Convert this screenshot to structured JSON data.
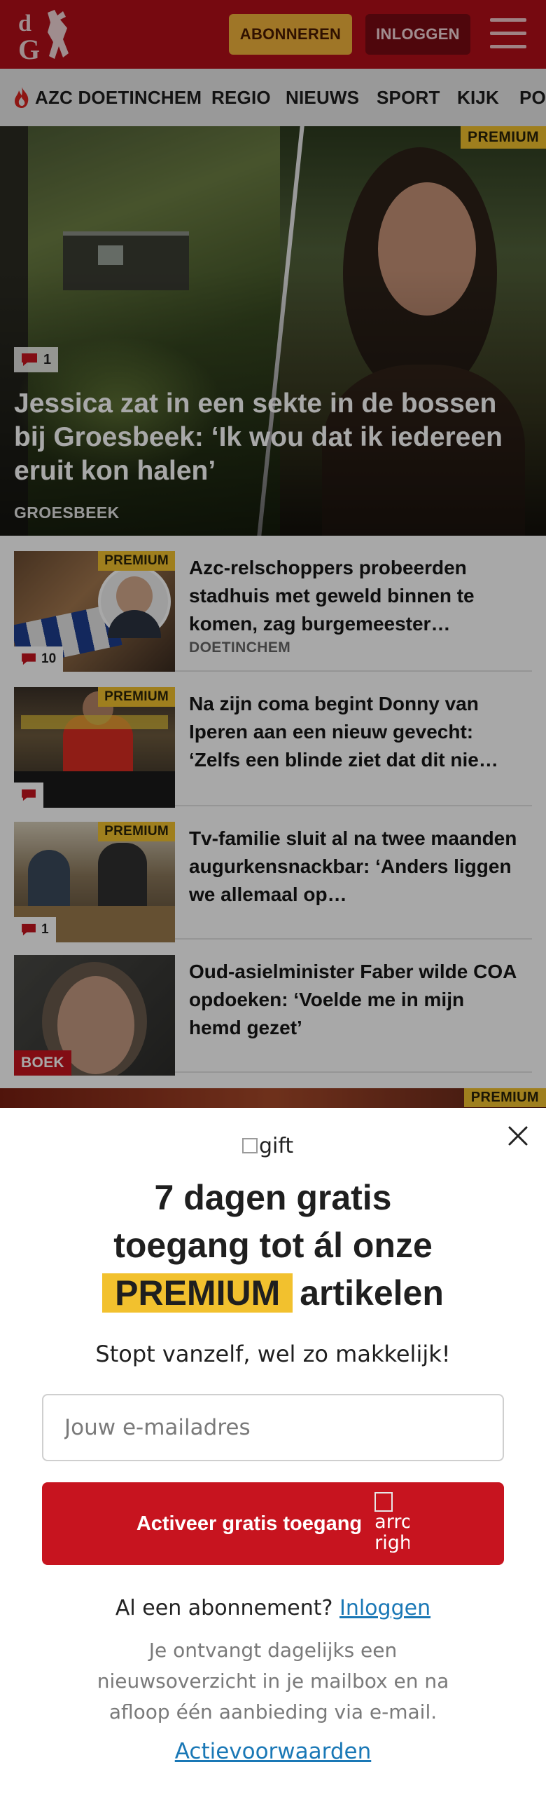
{
  "header": {
    "logo_text": "dG",
    "subscribe_label": "ABONNEREN",
    "login_label": "INLOGGEN",
    "brand_color": "#b30f19",
    "subscribe_color": "#f2b43c",
    "login_color": "#780a13"
  },
  "nav": {
    "items": [
      {
        "label": "AZC DOETINCHEM",
        "icon": "flame-icon"
      },
      {
        "label": "REGIO"
      },
      {
        "label": "NIEUWS"
      },
      {
        "label": "SPORT"
      },
      {
        "label": "KIJK"
      },
      {
        "label": "PO"
      }
    ]
  },
  "hero": {
    "premium": "PREMIUM",
    "comments": "1",
    "title": "Jessica zat in een sekte in de bossen bij Groesbeek: ‘Ik wou dat ik iedereen eruit kon halen’",
    "location": "GROESBEEK"
  },
  "articles": [
    {
      "title": "Azc-relschoppers probeerden stadhuis met geweld binnen te komen, zag burgemeester…",
      "location": "DOETINCHEM",
      "premium": "PREMIUM",
      "comments": "10"
    },
    {
      "title": "Na zijn coma begint Donny van Iperen aan een nieuw gevecht: ‘Zelfs een blinde ziet dat dit nie…",
      "premium": "PREMIUM",
      "comments": ""
    },
    {
      "title": "Tv-familie sluit al na twee maanden augurkensnackbar: ‘Anders liggen we allemaal op…",
      "premium": "PREMIUM",
      "comments": "1"
    },
    {
      "title": "Oud-asielminister Faber wilde COA opdoeken: ‘Voelde me in mijn hemd gezet’",
      "badge": "BOEK"
    }
  ],
  "peek_premium": "PREMIUM",
  "modal": {
    "gift_alt": "gift",
    "title_line1": "7 dagen gratis",
    "title_line2": "toegang tot ál onze",
    "title_highlight": "PREMIUM",
    "title_rest": "artikelen",
    "subtitle": "Stopt vanzelf, wel zo makkelijk!",
    "email_placeholder": "Jouw e-mailadres",
    "cta_label": "Activeer gratis toegang",
    "cta_icon_alt": "arrow-right",
    "already_text": "Al een abonnement?",
    "already_link": "Inloggen",
    "info": "Je ontvangt dagelijks een nieuwsoverzicht in je mailbox en na afloop één aanbieding via e-mail.",
    "terms": "Actievoorwaarden",
    "cta_color": "#c7141f",
    "highlight_color": "#f2c12e"
  }
}
